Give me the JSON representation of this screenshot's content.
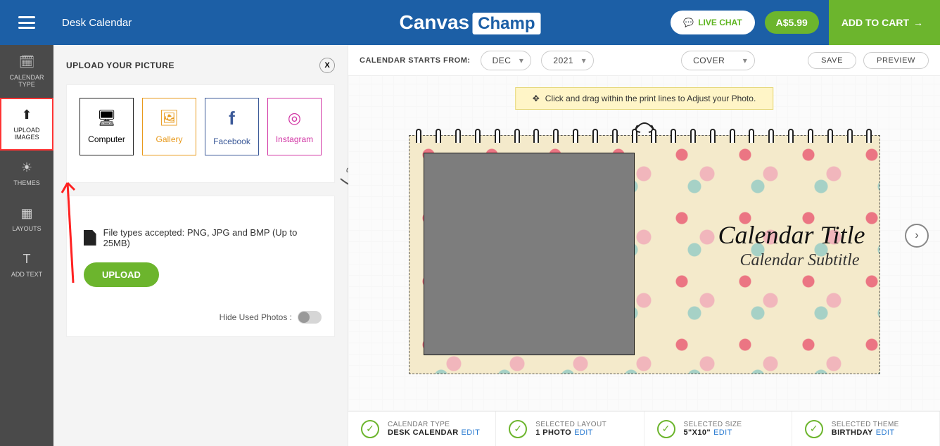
{
  "header": {
    "page_title": "Desk Calendar",
    "brand_left": "Canvas",
    "brand_right": "Champ",
    "live_chat": "LIVE CHAT",
    "price": "A$5.99",
    "add_cart": "ADD TO CART"
  },
  "leftbar": [
    {
      "id": "calendar-type",
      "label": "CALENDAR TYPE"
    },
    {
      "id": "upload-images",
      "label": "UPLOAD IMAGES"
    },
    {
      "id": "themes",
      "label": "THEMES"
    },
    {
      "id": "layouts",
      "label": "LAYOUTS"
    },
    {
      "id": "add-text",
      "label": "ADD TEXT"
    }
  ],
  "panel": {
    "title": "UPLOAD YOUR PICTURE",
    "close": "X",
    "sources": {
      "computer": "Computer",
      "gallery": "Gallery",
      "facebook": "Facebook",
      "instagram": "Instagram"
    },
    "file_note": "File types accepted: PNG, JPG and BMP (Up to 25MB)",
    "upload_btn": "UPLOAD",
    "hide_used": "Hide Used Photos :"
  },
  "annotation": {
    "drag_drop": "drag and drop"
  },
  "toolbar": {
    "starts_from": "CALENDAR STARTS FROM:",
    "month": "DEC",
    "year": "2021",
    "page": "COVER",
    "save": "SAVE",
    "preview": "PREVIEW"
  },
  "stage": {
    "tip": "Click and drag within the print lines to Adjust your Photo.",
    "cal_title": "Calendar Title",
    "cal_sub": "Calendar Subtitle"
  },
  "footer": [
    {
      "label": "CALENDAR TYPE",
      "value": "DESK CALENDAR",
      "edit": "EDIT"
    },
    {
      "label": "SELECTED LAYOUT",
      "value": "1 PHOTO",
      "edit": "EDIT"
    },
    {
      "label": "SELECTED SIZE",
      "value": "5\"X10\"",
      "edit": "EDIT"
    },
    {
      "label": "SELECTED THEME",
      "value": "BIRTHDAY",
      "edit": "EDIT"
    }
  ]
}
